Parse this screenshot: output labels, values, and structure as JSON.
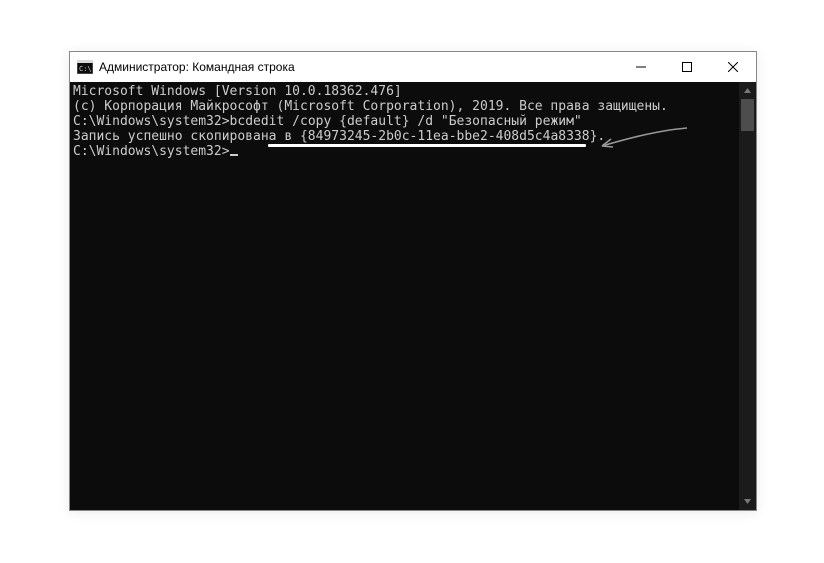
{
  "window": {
    "title": "Администратор: Командная строка"
  },
  "terminal": {
    "line1": "Microsoft Windows [Version 10.0.18362.476]",
    "line2": "(c) Корпорация Майкрософт (Microsoft Corporation), 2019. Все права защищены.",
    "blank1": "",
    "prompt1_path": "C:\\Windows\\system32>",
    "prompt1_cmd": "bcdedit /copy {default} /d \"Безопасный режим\"",
    "result_prefix": "Запись успешно скопирована в ",
    "result_guid": "{84973245-2b0c-11ea-bbe2-408d5c4a8338}",
    "result_suffix": ".",
    "blank2": "",
    "prompt2_path": "C:\\Windows\\system32>"
  }
}
